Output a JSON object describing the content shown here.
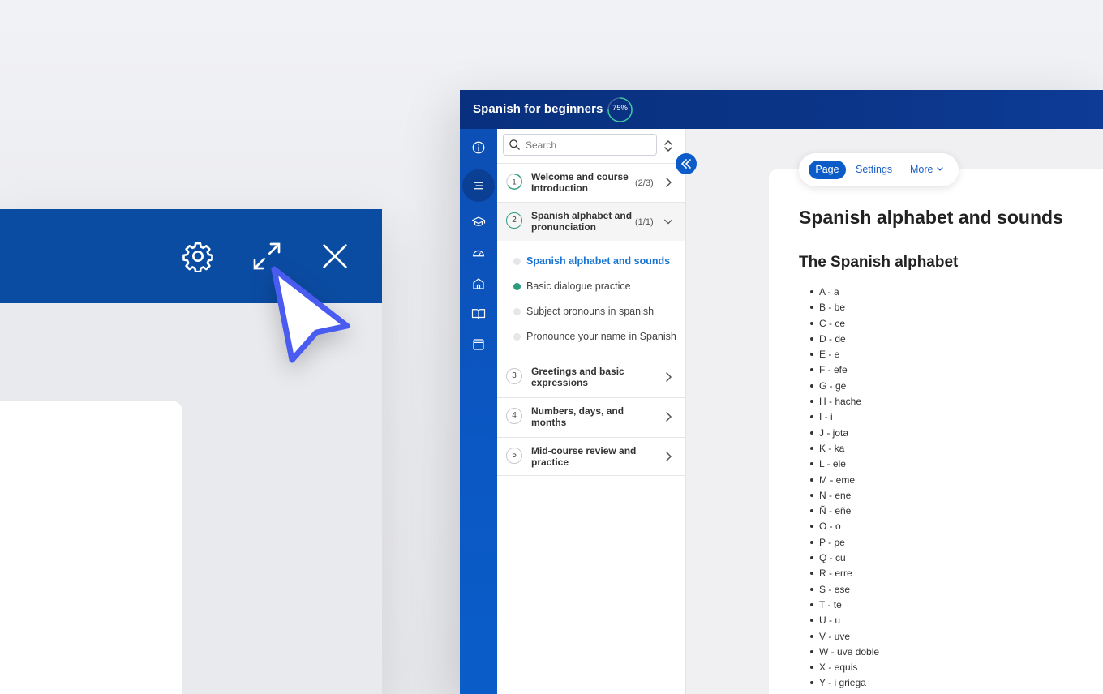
{
  "back_window": {
    "icons": [
      "gear-icon",
      "expand-icon",
      "close-icon"
    ]
  },
  "header": {
    "course_title": "Spanish for beginners",
    "progress_label": "75%",
    "progress_value": 0.75
  },
  "rail": {
    "icons": [
      "info-icon",
      "outline-icon",
      "graduation-cap-icon",
      "dashboard-icon",
      "home-icon",
      "book-icon",
      "window-icon"
    ]
  },
  "sidebar": {
    "search_placeholder": "Search",
    "chapters": [
      {
        "num": "1",
        "title": "Welcome and course Introduction",
        "count": "(2/3)"
      },
      {
        "num": "2",
        "title": "Spanish alphabet and pronunciation",
        "count": "(1/1)"
      },
      {
        "num": "3",
        "title": "Greetings and basic expressions",
        "count": ""
      },
      {
        "num": "4",
        "title": "Numbers, days, and months",
        "count": ""
      },
      {
        "num": "5",
        "title": "Mid-course review and practice",
        "count": ""
      }
    ],
    "lessons": [
      {
        "title": "Spanish alphabet and sounds",
        "state": "active"
      },
      {
        "title": "Basic dialogue practice",
        "state": "done"
      },
      {
        "title": "Subject pronouns in spanish",
        "state": "todo"
      },
      {
        "title": "Pronounce your name in Spanish",
        "state": "todo"
      }
    ]
  },
  "tabs": {
    "page": "Page",
    "settings": "Settings",
    "more": "More"
  },
  "content": {
    "page_title": "Spanish alphabet and sounds",
    "section_title": "The Spanish alphabet",
    "alphabet": [
      "A - a",
      "B - be",
      "C - ce",
      "D - de",
      "E - e",
      "F - efe",
      "G - ge",
      "H - hache",
      "I - i",
      "J - jota",
      "K - ka",
      "L - ele",
      "M - eme",
      "N - ene",
      "Ñ - eñe",
      "O - o",
      "P - pe",
      "Q - cu",
      "R - erre",
      "S - ese",
      "T - te",
      "U - u",
      "V - uve",
      "W - uve doble",
      "X - equis",
      "Y - i griega"
    ]
  },
  "colors": {
    "brand_blue": "#0b4ca3",
    "header_navy": "#08307e",
    "accent_blue": "#0b5cc9",
    "active_link": "#1a75d2",
    "done_green": "#2a9c80",
    "cursor": "#4a5bf0"
  }
}
